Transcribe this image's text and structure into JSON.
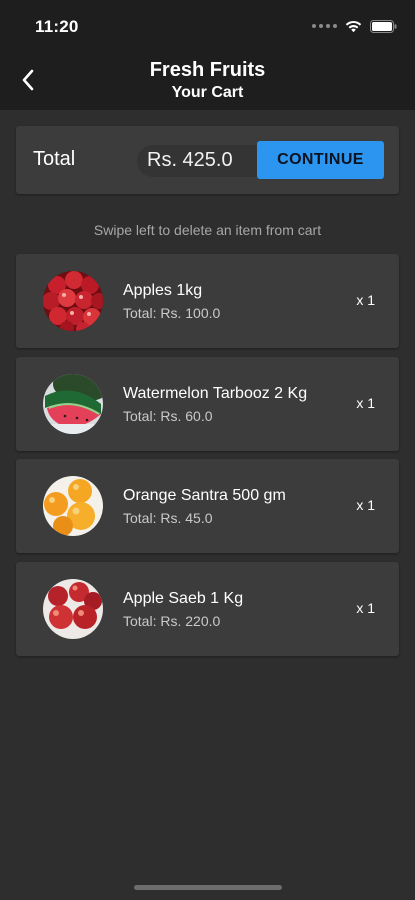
{
  "status_bar": {
    "time": "11:20"
  },
  "header": {
    "title": "Fresh Fruits",
    "subtitle": "Your Cart"
  },
  "summary": {
    "total_label": "Total",
    "total_value": "Rs. 425.0",
    "continue_label": "CONTINUE"
  },
  "hint": "Swipe left to delete an item from cart",
  "items": [
    {
      "name": "Apples 1kg",
      "total": "Total: Rs. 100.0",
      "qty": "x 1",
      "image_icon": "apples-image"
    },
    {
      "name": "Watermelon Tarbooz 2 Kg",
      "total": "Total: Rs. 60.0",
      "qty": "x 1",
      "image_icon": "watermelon-image"
    },
    {
      "name": "Orange Santra 500 gm",
      "total": "Total: Rs. 45.0",
      "qty": "x 1",
      "image_icon": "oranges-image"
    },
    {
      "name": "Apple Saeb 1 Kg",
      "total": "Total: Rs. 220.0",
      "qty": "x 1",
      "image_icon": "red-apples-image"
    }
  ],
  "colors": {
    "background": "#2e2e2e",
    "header": "#1e1e1e",
    "card": "#3c3c3c",
    "accent": "#2c95f0"
  }
}
